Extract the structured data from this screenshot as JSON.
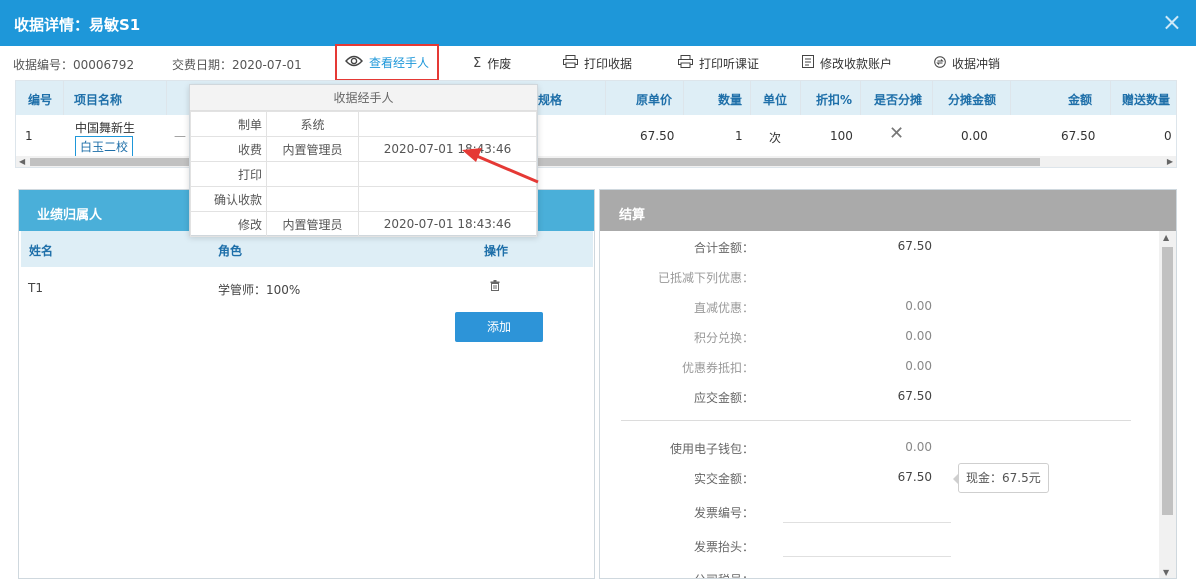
{
  "dialog": {
    "title": "收据详情：易敏S1",
    "close": "×"
  },
  "toolbar": {
    "receipt_no": "收据编号：00006792",
    "trade_date": "交费日期：2020-07-01",
    "view_handler": "查看经手人",
    "void": "作废",
    "print_receipt": "打印收据",
    "print_ticket": "打印听课证",
    "edit_account": "修改收款账户",
    "reverse": "收据冲销"
  },
  "grid": {
    "headers": {
      "no": "编号",
      "item": "项目名称",
      "spec": "规格",
      "orig_price": "原单价",
      "qty": "数量",
      "unit": "单位",
      "discount": "折扣%",
      "split": "是否分摊",
      "split_amount": "分摊金额",
      "amount": "金额",
      "gift_qty": "赠送数量"
    },
    "row": {
      "no": "1",
      "item": "中国舞新生",
      "campus": "白玉二校",
      "dash": "—",
      "orig_price": "67.50",
      "qty": "1",
      "unit": "次",
      "discount": "100",
      "split": "✕",
      "split_amount": "0.00",
      "amount": "67.50",
      "gift_qty": "0"
    }
  },
  "handler_popup": {
    "title": "收据经手人",
    "rows": [
      {
        "k": "制单",
        "n": "系统",
        "t": ""
      },
      {
        "k": "收费",
        "n": "内置管理员",
        "t": "2020-07-01 18:43:46"
      },
      {
        "k": "打印",
        "n": "",
        "t": ""
      },
      {
        "k": "确认收款",
        "n": "",
        "t": ""
      },
      {
        "k": "修改",
        "n": "内置管理员",
        "t": "2020-07-01 18:43:46"
      }
    ]
  },
  "performance": {
    "title": "业绩归属人",
    "headers": {
      "name": "姓名",
      "role": "角色",
      "action": "操作"
    },
    "row": {
      "name": "T1",
      "role": "学管师：100%",
      "delete_icon": "trash-icon"
    },
    "add": "添加"
  },
  "settlement": {
    "title": "结算",
    "total_label": "合计金额：",
    "total": "67.50",
    "deduct_label": "已抵减下列优惠：",
    "direct_label": "直减优惠：",
    "direct": "0.00",
    "points_label": "积分兑换：",
    "points": "0.00",
    "coupon_label": "优惠券抵扣：",
    "coupon": "0.00",
    "due_label": "应交金额：",
    "due": "67.50",
    "wallet_label": "使用电子钱包：",
    "wallet": "0.00",
    "paid_label": "实交金额：",
    "paid": "67.50",
    "cash_tip": "现金：67.5元",
    "invoice_no_label": "发票编号：",
    "invoice_title_label": "发票抬头：",
    "tax_no_label": "公司税号："
  },
  "colors": {
    "header_blue": "#1e97d9",
    "panel_blue": "#4aafd9",
    "highlight_red": "#e53935"
  }
}
